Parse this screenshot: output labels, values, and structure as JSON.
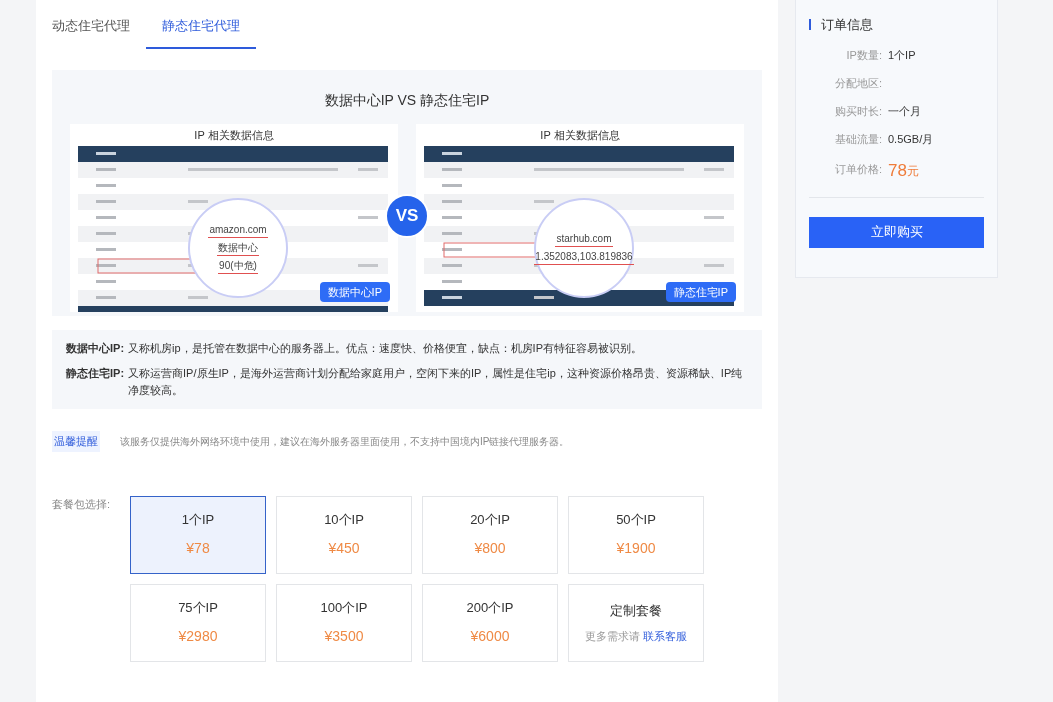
{
  "tabs": [
    {
      "label": "动态住宅代理",
      "selected": false
    },
    {
      "label": "静态住宅代理",
      "selected": true
    }
  ],
  "comparison": {
    "title": "数据中心IP VS 静态住宅IP",
    "vs": "VS",
    "panels": [
      {
        "heading": "IP 相关数据信息",
        "magnified": [
          "amazon.com",
          "数据中心",
          "90(中危)"
        ],
        "badge": "数据中心IP"
      },
      {
        "heading": "IP 相关数据信息",
        "magnified": [
          "starhub.com",
          "1.352083,103.819836"
        ],
        "badge": "静态住宅IP"
      }
    ]
  },
  "descriptions": [
    {
      "term": "数据中心IP:",
      "text": "又称机房ip，是托管在数据中心的服务器上。优点：速度快、价格便宜，缺点：机房IP有特征容易被识别。"
    },
    {
      "term": "静态住宅IP:",
      "text": "又称运营商IP/原生IP，是海外运营商计划分配给家庭用户，空闲下来的IP，属性是住宅ip，这种资源价格昂贵、资源稀缺、IP纯净度较高。"
    }
  ],
  "notice": {
    "tag": "温馨提醒",
    "text": "该服务仅提供海外网络环境中使用，建议在海外服务器里面使用，不支持中国境内IP链接代理服务器。"
  },
  "packages": {
    "label": "套餐包选择:",
    "items": [
      {
        "kind": "plan",
        "name": "1个IP",
        "price": "¥78",
        "selected": true
      },
      {
        "kind": "plan",
        "name": "10个IP",
        "price": "¥450",
        "selected": false
      },
      {
        "kind": "plan",
        "name": "20个IP",
        "price": "¥800",
        "selected": false
      },
      {
        "kind": "plan",
        "name": "50个IP",
        "price": "¥1900",
        "selected": false
      },
      {
        "kind": "plan",
        "name": "75个IP",
        "price": "¥2980",
        "selected": false
      },
      {
        "kind": "plan",
        "name": "100个IP",
        "price": "¥3500",
        "selected": false
      },
      {
        "kind": "plan",
        "name": "200个IP",
        "price": "¥6000",
        "selected": false
      },
      {
        "kind": "custom",
        "name": "定制套餐",
        "note": "更多需求请",
        "link": "联系客服",
        "selected": false
      }
    ]
  },
  "order": {
    "title": "订单信息",
    "rows": [
      {
        "label": "IP数量:",
        "value": "1个IP"
      },
      {
        "label": "分配地区:"
      },
      {
        "label": "购买时长:",
        "value": "一个月"
      },
      {
        "label": "基础流量:",
        "value": "0.5GB/月"
      }
    ],
    "price_label": "订单价格:",
    "price": "78",
    "unit": "元",
    "button": "立即购买"
  }
}
